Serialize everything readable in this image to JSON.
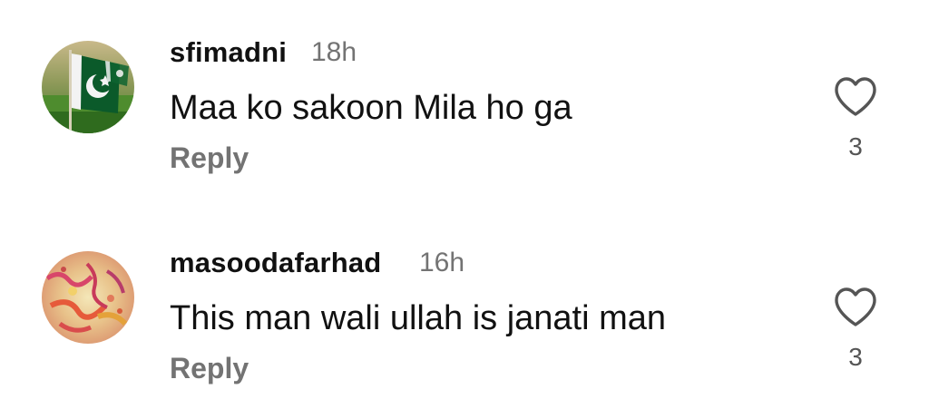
{
  "comments": [
    {
      "username": "sfimadni",
      "time": "18h",
      "text": "Maa ko sakoon Mila ho ga",
      "reply_label": "Reply",
      "likes": "3",
      "avatar_icon": "pakistan-flag-avatar"
    },
    {
      "username": "masoodafarhad",
      "time": "16h",
      "text": "This man wali ullah is janati man",
      "reply_label": "Reply",
      "likes": "3",
      "avatar_icon": "colorful-calligraphy-avatar"
    }
  ],
  "colors": {
    "username": "#111111",
    "secondary": "#737373",
    "text": "#111111"
  }
}
